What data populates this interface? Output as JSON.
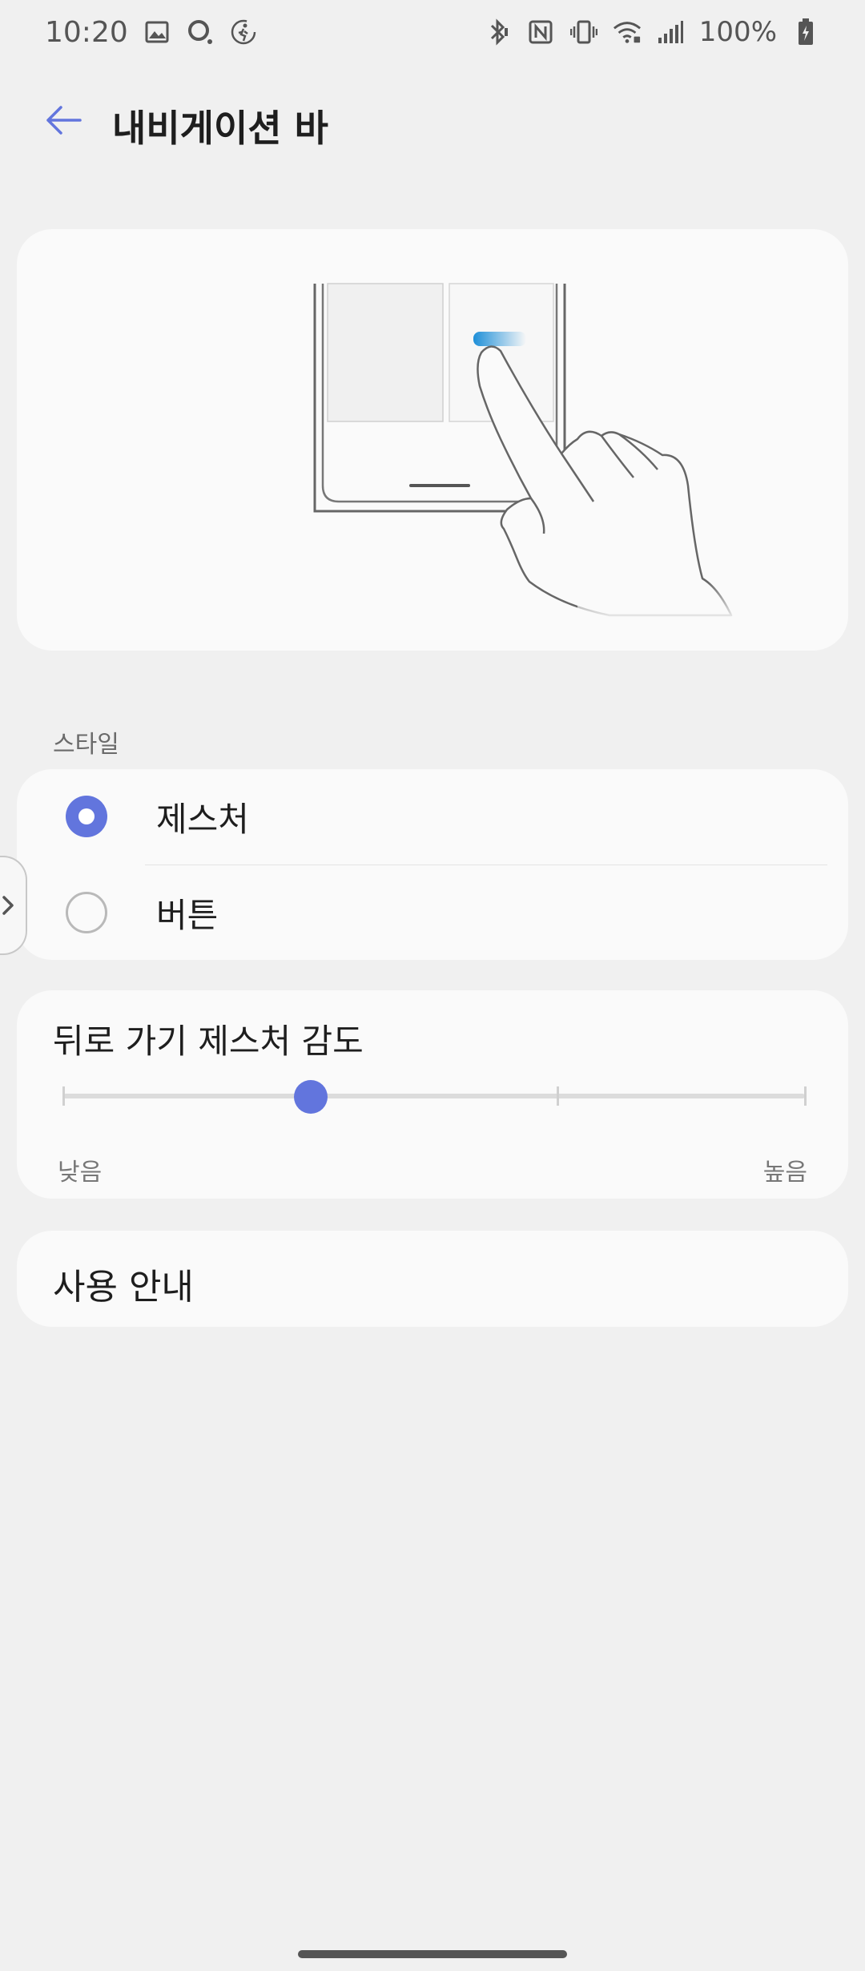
{
  "status_bar": {
    "time": "10:20",
    "battery": "100%",
    "icons_left": [
      "image-icon",
      "search-icon",
      "activity-icon"
    ],
    "icons_right": [
      "bluetooth-icon",
      "nfc-icon",
      "vibrate-icon",
      "wifi-icon",
      "signal-icon",
      "battery-icon"
    ]
  },
  "app_bar": {
    "title": "내비게이션 바"
  },
  "style_section": {
    "label": "스타일",
    "options": [
      {
        "label": "제스처",
        "selected": true
      },
      {
        "label": "버튼",
        "selected": false
      }
    ]
  },
  "sensitivity": {
    "title": "뒤로 가기 제스처 감도",
    "min_label": "낮음",
    "max_label": "높음",
    "steps": 4,
    "value_index": 1
  },
  "guide": {
    "label": "사용 안내"
  },
  "colors": {
    "accent": "#6275dd",
    "background": "#f0f0f0",
    "card": "#fafafa",
    "gesture_blue": "#1e8fd8"
  }
}
